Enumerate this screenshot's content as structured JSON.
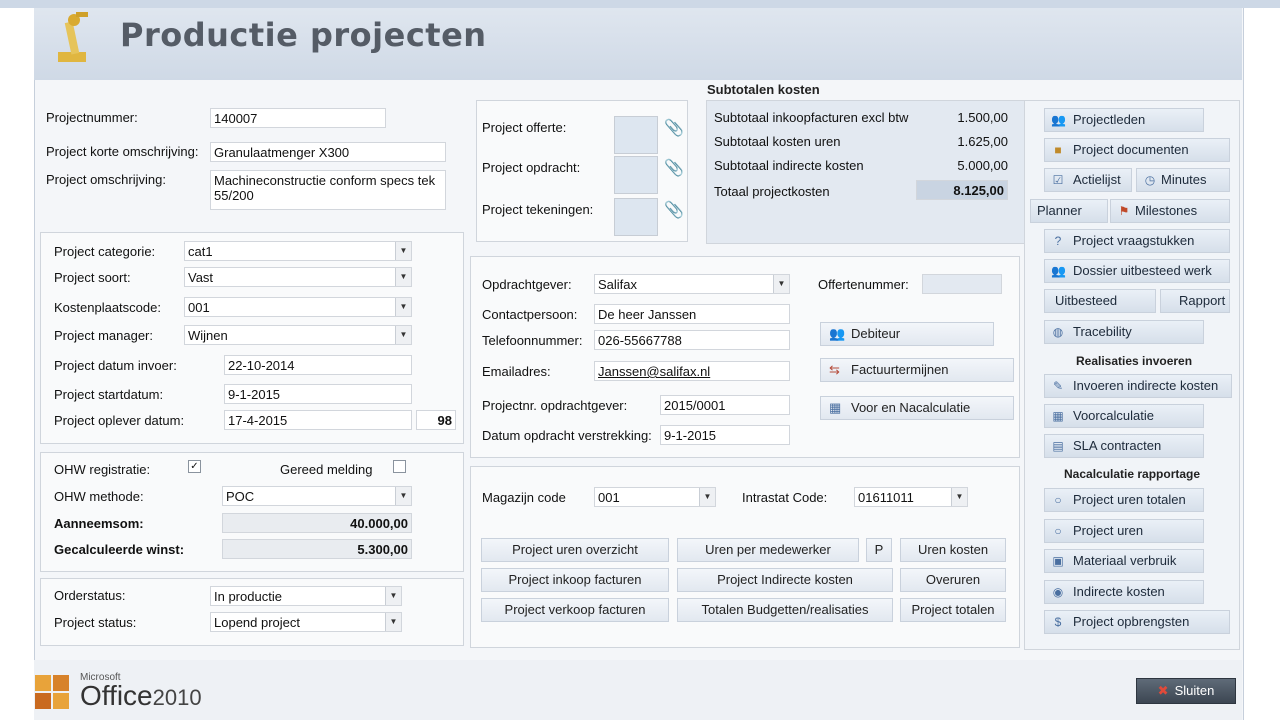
{
  "app": {
    "title": "Productie projecten",
    "logo_icon": "robot-arm-icon",
    "office_brand": "Office",
    "office_version": "2010",
    "office_vendor": "Microsoft"
  },
  "project": {
    "nummer_label": "Projectnummer:",
    "nummer_value": "140007",
    "korte_label": "Project korte omschrijving:",
    "korte_value": "Granulaatmenger X300",
    "omschrijving_label": "Project omschrijving:",
    "omschrijving_value": "Machineconstructie conform specs tek 55/200"
  },
  "attachments": {
    "offerte_label": "Project offerte:",
    "opdracht_label": "Project opdracht:",
    "tekeningen_label": "Project tekeningen:",
    "clip_icon": "paperclip-icon"
  },
  "subtotals": {
    "title": "Subtotalen kosten",
    "rows": [
      {
        "label": "Subtotaal inkoopfacturen excl btw",
        "value": "1.500,00"
      },
      {
        "label": "Subtotaal kosten uren",
        "value": "1.625,00"
      },
      {
        "label": "Subtotaal indirecte kosten",
        "value": "5.000,00"
      }
    ],
    "total_label": "Totaal projectkosten",
    "total_value": "8.125,00"
  },
  "details": {
    "categorie_label": "Project categorie:",
    "categorie_value": "cat1",
    "soort_label": "Project soort:",
    "soort_value": "Vast",
    "kostenplaats_label": "Kostenplaatscode:",
    "kostenplaats_value": "001",
    "manager_label": "Project manager:",
    "manager_value": "Wijnen",
    "invoer_label": "Project datum invoer:",
    "invoer_value": "22-10-2014",
    "start_label": "Project startdatum:",
    "start_value": "9-1-2015",
    "oplever_label": "Project oplever datum:",
    "oplever_value": "17-4-2015",
    "days_value": "98"
  },
  "ohw": {
    "registratie_label": "OHW registratie:",
    "registratie_checked": "✓",
    "gereed_label": "Gereed melding",
    "methode_label": "OHW methode:",
    "methode_value": "POC",
    "aanneem_label": "Aanneemsom:",
    "aanneem_value": "40.000,00",
    "winst_label": "Gecalculeerde winst:",
    "winst_value": "5.300,00"
  },
  "status": {
    "orderstatus_label": "Orderstatus:",
    "orderstatus_value": "In productie",
    "projectstatus_label": "Project status:",
    "projectstatus_value": "Lopend project"
  },
  "client": {
    "opdrachtgever_label": "Opdrachtgever:",
    "opdrachtgever_value": "Salifax",
    "contact_label": "Contactpersoon:",
    "contact_value": "De heer Janssen",
    "telefoon_label": "Telefoonnummer:",
    "telefoon_value": "026-55667788",
    "email_label": "Emailadres:",
    "email_value": "Janssen@salifax.nl",
    "projectnr_label": "Projectnr. opdrachtgever:",
    "projectnr_value": "2015/0001",
    "verstrekking_label": "Datum opdracht verstrekking:",
    "verstrekking_value": "9-1-2015",
    "offertenummer_label": "Offertenummer:",
    "offertenummer_value": ""
  },
  "client_buttons": {
    "debiteur": "Debiteur",
    "factuurtermijnen": "Factuurtermijnen",
    "voor_na": "Voor en Nacalculatie"
  },
  "warehouse": {
    "magazijn_label": "Magazijn code",
    "magazijn_value": "001",
    "intrastat_label": "Intrastat Code:",
    "intrastat_value": "01611011"
  },
  "report_buttons": {
    "row1": [
      "Project uren overzicht",
      "Uren per medewerker",
      "P",
      "Uren kosten"
    ],
    "row2": [
      "Project inkoop facturen",
      "Project Indirecte kosten",
      "Overuren"
    ],
    "row3": [
      "Project verkoop facturen",
      "Totalen Budgetten/realisaties",
      "Project totalen"
    ]
  },
  "sidebar": {
    "items": [
      {
        "label": "Projectleden",
        "icon": "people-icon"
      },
      {
        "label": "Project documenten",
        "icon": "folder-icon"
      }
    ],
    "actielijst": "Actielijst",
    "minutes": "Minutes",
    "planner": "Planner",
    "milestones": "Milestones",
    "items2": [
      {
        "label": "Project vraagstukken",
        "icon": "question-icon"
      },
      {
        "label": "Dossier uitbesteed werk",
        "icon": "people-icon"
      }
    ],
    "uitbesteed": "Uitbesteed",
    "rapport": "Rapport",
    "tracebility": "Tracebility",
    "realisaties_title": "Realisaties invoeren",
    "realisaties": [
      {
        "label": "Invoeren indirecte kosten",
        "icon": "edit-icon"
      },
      {
        "label": "Voorcalculatie",
        "icon": "calc-icon"
      },
      {
        "label": "SLA contracten",
        "icon": "contract-icon"
      }
    ],
    "nacalc_title": "Nacalculatie rapportage",
    "nacalc": [
      {
        "label": "Project uren totalen",
        "icon": "radio-icon"
      },
      {
        "label": "Project uren",
        "icon": "radio-icon"
      },
      {
        "label": "Materiaal verbruik",
        "icon": "box-icon"
      },
      {
        "label": "Indirecte kosten",
        "icon": "coins-icon"
      },
      {
        "label": "Project opbrengsten",
        "icon": "money-icon"
      }
    ]
  },
  "footer": {
    "sluiten": "Sluiten",
    "sluiten_icon": "close-icon"
  }
}
